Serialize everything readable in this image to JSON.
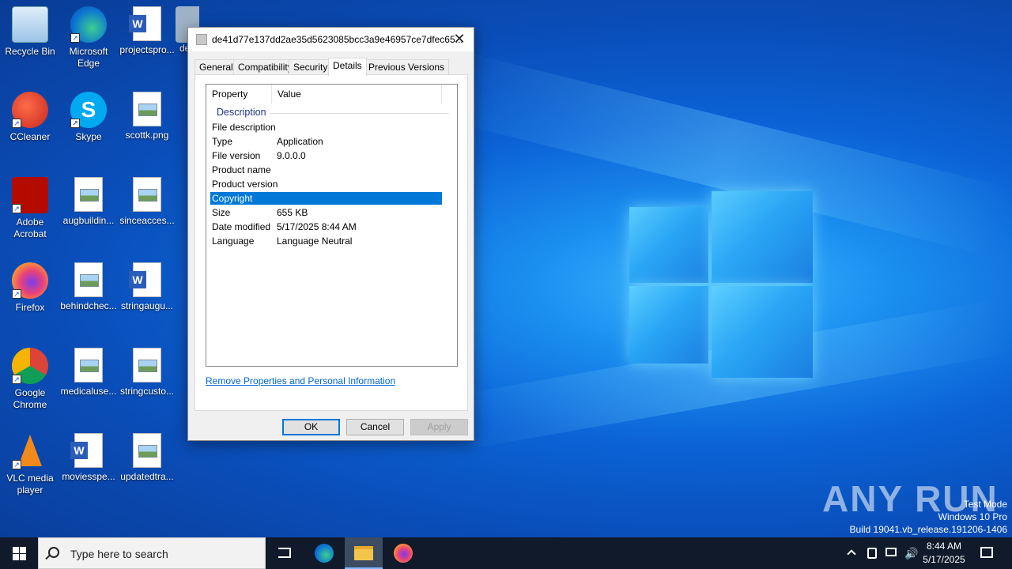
{
  "desktop": {
    "icons": [
      {
        "label": "Recycle Bin"
      },
      {
        "label": "Microsoft Edge"
      },
      {
        "label": "projectspro..."
      },
      {
        "label": "de"
      },
      {
        "label": "CCleaner"
      },
      {
        "label": "Skype"
      },
      {
        "label": "scottk.png"
      },
      {
        "label": "Adobe Acrobat"
      },
      {
        "label": "augbuildin..."
      },
      {
        "label": "sinceacces..."
      },
      {
        "label": "Firefox"
      },
      {
        "label": "behindchec..."
      },
      {
        "label": "stringaugu..."
      },
      {
        "label": "Google Chrome"
      },
      {
        "label": "medicaluse..."
      },
      {
        "label": "stringcusto..."
      },
      {
        "label": "VLC media player"
      },
      {
        "label": "moviesspe..."
      },
      {
        "label": "updatedtra..."
      }
    ]
  },
  "dialog": {
    "title": "de41d77e137dd2ae35d5623085bcc3a9e46957ce7dfec65...",
    "close_glyph": "✕",
    "tabs": [
      "General",
      "Compatibility",
      "Security",
      "Details",
      "Previous Versions"
    ],
    "active_tab": "Details",
    "columns": {
      "property": "Property",
      "value": "Value"
    },
    "group": "Description",
    "rows": [
      {
        "property": "File description",
        "value": ""
      },
      {
        "property": "Type",
        "value": "Application"
      },
      {
        "property": "File version",
        "value": "9.0.0.0"
      },
      {
        "property": "Product name",
        "value": ""
      },
      {
        "property": "Product version",
        "value": ""
      },
      {
        "property": "Copyright",
        "value": "",
        "selected": true
      },
      {
        "property": "Size",
        "value": "655 KB"
      },
      {
        "property": "Date modified",
        "value": "5/17/2025 8:44 AM"
      },
      {
        "property": "Language",
        "value": "Language Neutral"
      }
    ],
    "remove_link": "Remove Properties and Personal Information",
    "buttons": {
      "ok": "OK",
      "cancel": "Cancel",
      "apply": "Apply"
    }
  },
  "watermark": {
    "brand": "ANY RUN",
    "line1": "Test Mode",
    "line2": "Windows 10 Pro",
    "line3": "Build 19041.vb_release.191206-1406"
  },
  "taskbar": {
    "search_placeholder": "Type here to search",
    "clock_time": "8:44 AM",
    "clock_date": "5/17/2025"
  },
  "colors": {
    "accent": "#0078d7",
    "taskbar": "#101a2a"
  }
}
